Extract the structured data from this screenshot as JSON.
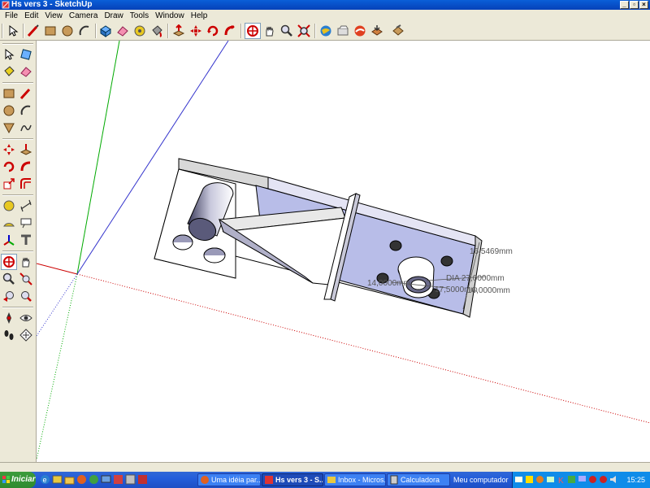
{
  "window": {
    "title": "Hs vers 3 - SketchUp"
  },
  "menu": [
    "File",
    "Edit",
    "View",
    "Camera",
    "Draw",
    "Tools",
    "Window",
    "Help"
  ],
  "toolbar": {
    "icons": [
      "select-icon",
      "pencil-line-icon",
      "rectangle-icon",
      "circle-icon",
      "arc-icon",
      "make-component-icon",
      "eraser-icon",
      "tape-measure-icon",
      "paint-bucket-icon",
      "push-pull-icon",
      "move-icon",
      "rotate-icon",
      "follow-me-icon",
      "orbit-icon",
      "pan-icon",
      "zoom-icon",
      "zoom-extents-icon",
      "get-models-icon",
      "share-model-icon",
      "google-earth-icon",
      "components-icon"
    ]
  },
  "left_toolbar": {
    "icons": [
      "select-icon",
      "make-component-icon",
      "paint-bucket-icon",
      "eraser-icon",
      "rectangle-icon",
      "line-icon",
      "circle-icon",
      "arc-icon",
      "polygon-icon",
      "freehand-icon",
      "move-icon",
      "push-pull-icon",
      "rotate-icon",
      "follow-me-icon",
      "scale-icon",
      "offset-icon",
      "tape-measure-icon",
      "dimension-icon",
      "protractor-icon",
      "text-icon",
      "axes-icon",
      "3d-text-icon",
      "orbit-icon",
      "pan-icon",
      "zoom-icon",
      "zoom-window-icon",
      "previous-view-icon",
      "zoom-extents-icon",
      "position-camera-icon",
      "look-around-icon",
      "walk-icon",
      "section-plane-icon"
    ]
  },
  "dimensions": {
    "d1": "16,5469mm",
    "d2": "DIA 27,0000mm",
    "d3": "14,0000mm",
    "d4": "17,5000mm",
    "d5": "16,0000mm"
  },
  "taskbar": {
    "start_label": "Iniciar",
    "tasks": [
      {
        "label": "Uma idéia par...",
        "active": false
      },
      {
        "label": "Hs vers 3 - S...",
        "active": true
      },
      {
        "label": "Inbox - Micros...",
        "active": false
      },
      {
        "label": "Calculadora",
        "active": false
      }
    ],
    "my_computer": "Meu computador",
    "clock": "15:25"
  },
  "colors": {
    "titlebar": "#0a5fd8",
    "model_face_blue": "#b8bde8",
    "model_face_white": "#ffffff",
    "axis_red": "#cc0000",
    "axis_green": "#00aa00",
    "axis_blue": "#3333cc"
  }
}
